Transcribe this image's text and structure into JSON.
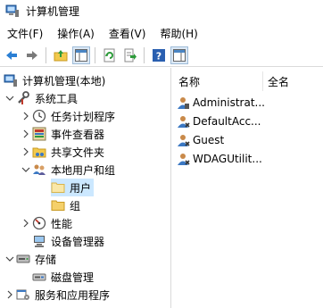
{
  "window": {
    "title": "计算机管理"
  },
  "menu": [
    "文件(F)",
    "操作(A)",
    "查看(V)",
    "帮助(H)"
  ],
  "toolbar": [
    "back-icon",
    "forward-icon",
    "up-folder-icon",
    "show-hide-tree-icon",
    "refresh-icon",
    "export-list-icon",
    "help-icon",
    "properties-pane-icon"
  ],
  "tree": {
    "root": "计算机管理(本地)",
    "system_tools": "系统工具",
    "task_scheduler": "任务计划程序",
    "event_viewer": "事件查看器",
    "shared_folders": "共享文件夹",
    "local_users_groups": "本地用户和组",
    "users": "用户",
    "groups": "组",
    "performance": "性能",
    "device_manager": "设备管理器",
    "storage": "存储",
    "disk_management": "磁盘管理",
    "services_apps": "服务和应用程序"
  },
  "list": {
    "columns": [
      "名称",
      "全名"
    ],
    "rows": [
      {
        "name": "Administrat...",
        "fullname": ""
      },
      {
        "name": "DefaultAcc...",
        "fullname": ""
      },
      {
        "name": "Guest",
        "fullname": ""
      },
      {
        "name": "WDAGUtilit...",
        "fullname": ""
      }
    ]
  },
  "colors": {
    "selection": "#cce8ff",
    "folder": "#f5d06a",
    "accent_blue": "#1e73be"
  }
}
